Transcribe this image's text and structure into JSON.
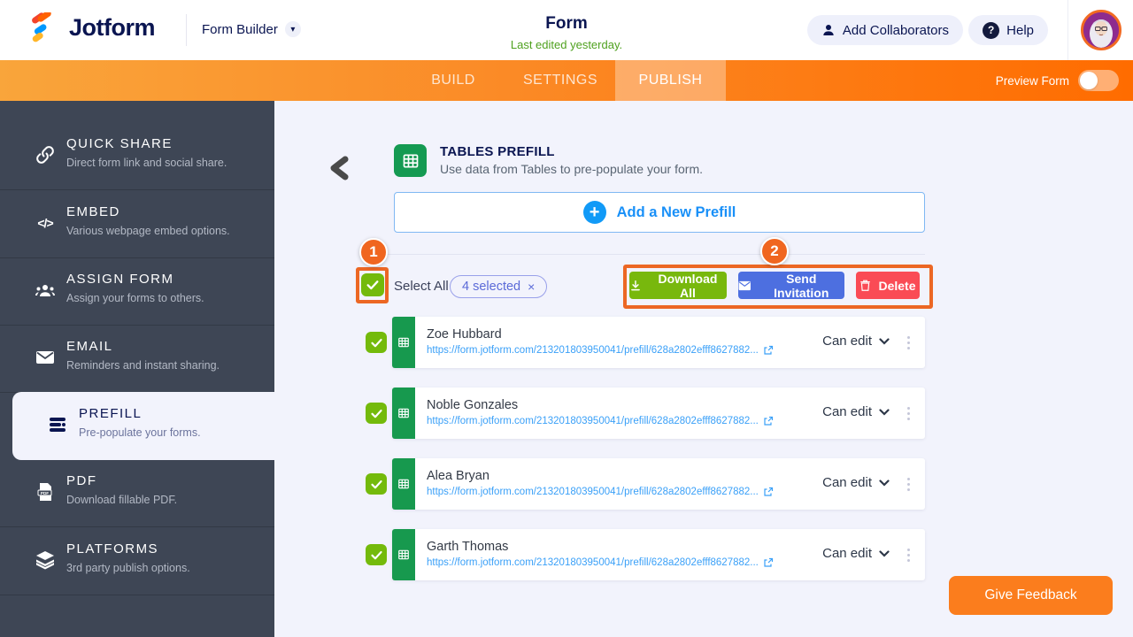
{
  "header": {
    "logo_text": "Jotform",
    "product_switcher": "Form Builder",
    "form_title": "Form",
    "last_edited": "Last edited yesterday.",
    "add_collaborators_label": "Add Collaborators",
    "help_label": "Help"
  },
  "nav": {
    "tabs": [
      {
        "label": "BUILD",
        "active": false
      },
      {
        "label": "SETTINGS",
        "active": false
      },
      {
        "label": "PUBLISH",
        "active": true
      }
    ],
    "preview_form_label": "Preview Form",
    "preview_toggle_state": "off"
  },
  "sidebar": {
    "items": [
      {
        "label": "QUICK SHARE",
        "desc": "Direct form link and social share.",
        "icon": "link-icon",
        "active": false
      },
      {
        "label": "EMBED",
        "desc": "Various webpage embed options.",
        "icon": "code-icon",
        "active": false
      },
      {
        "label": "ASSIGN FORM",
        "desc": "Assign your forms to others.",
        "icon": "people-icon",
        "active": false
      },
      {
        "label": "EMAIL",
        "desc": "Reminders and instant sharing.",
        "icon": "envelope-icon",
        "active": false
      },
      {
        "label": "PREFILL",
        "desc": "Pre-populate your forms.",
        "icon": "prefill-icon",
        "active": true
      },
      {
        "label": "PDF",
        "desc": "Download fillable PDF.",
        "icon": "pdf-icon",
        "active": false
      },
      {
        "label": "PLATFORMS",
        "desc": "3rd party publish options.",
        "icon": "layers-icon",
        "active": false
      }
    ]
  },
  "main": {
    "section_title": "TABLES PREFILL",
    "section_desc": "Use data from Tables to pre-populate your form.",
    "add_button_label": "Add a New Prefill",
    "select_all_label": "Select All",
    "selected_badge": "4 selected",
    "badge_close": "×",
    "actions": {
      "download": "Download All",
      "send": "Send Invitation",
      "delete": "Delete"
    },
    "permission_label": "Can edit",
    "rows": [
      {
        "name": "Zoe Hubbard",
        "url": "https://form.jotform.com/213201803950041/prefill/628a2802efff8627882...",
        "checked": true
      },
      {
        "name": "Noble Gonzales",
        "url": "https://form.jotform.com/213201803950041/prefill/628a2802efff8627882...",
        "checked": true
      },
      {
        "name": "Alea Bryan",
        "url": "https://form.jotform.com/213201803950041/prefill/628a2802efff8627882...",
        "checked": true
      },
      {
        "name": "Garth Thomas",
        "url": "https://form.jotform.com/213201803950041/prefill/628a2802efff8627882...",
        "checked": true
      }
    ],
    "annotations": [
      "1",
      "2"
    ],
    "give_feedback_label": "Give Feedback"
  },
  "colors": {
    "brand_orange": "#ff6c00",
    "nav_gradient_start": "#f9a53b",
    "annotation_orange": "#ec6724",
    "checkbox_green": "#74ba0b",
    "table_green": "#17994e",
    "download_green": "#78b80d",
    "send_blue": "#4d6fe0",
    "delete_red": "#fa4b55",
    "link_blue": "#3aa0f8",
    "add_prefill_blue": "#1990f8",
    "navy_text": "#0a1551",
    "sidebar_bg": "#3e4655",
    "edited_green": "#4fa11f"
  }
}
